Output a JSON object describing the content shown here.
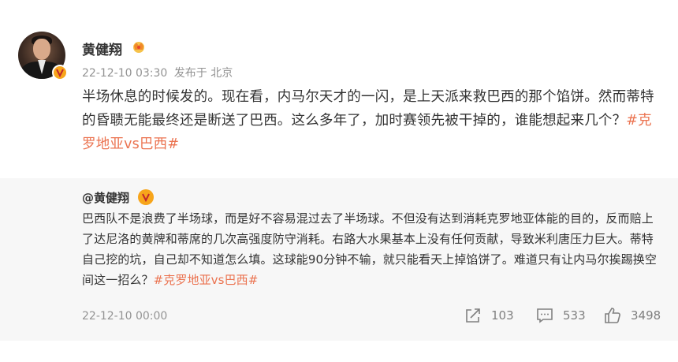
{
  "post": {
    "author": "黄健翔",
    "time": "22-12-10 03:30",
    "source": "发布于 北京",
    "text_main": "半场休息的时候发的。现在看，内马尔天才的一闪，是上天派来救巴西的那个馅饼。然而蒂特的昏聩无能最终还是断送了巴西。这么多年了，加时赛领先被干掉的，谁能想起来几个？",
    "hashtag": "#克罗地亚vs巴西#"
  },
  "repost": {
    "author": "@黄健翔",
    "text_main": "巴西队不是浪费了半场球，而是好不容易混过去了半场球。不但没有达到消耗克罗地亚体能的目的，反而赔上了达尼洛的黄牌和蒂席的几次高强度防守消耗。右路大水果基本上没有任何贡献，导致米利唐压力巨大。蒂特自己挖的坑，自己却不知道怎么填。这球能90分钟不输，就只能看天上掉馅饼了。难道只有让内马尔挨踢换空间这一招么？",
    "hashtag": "#克罗地亚vs巴西#",
    "time": "22-12-10 00:00",
    "share_count": "103",
    "comment_count": "533",
    "like_count": "3498"
  },
  "icons": {
    "verified": "verified-v-badge",
    "crown": "crown-icon",
    "share": "share-icon",
    "comment": "comment-icon",
    "like": "thumbs-up-icon"
  },
  "colors": {
    "hashtag": "#eb7350",
    "meta": "#939393",
    "repost_bg": "#f7f7f7",
    "badge": "#f7a51b"
  }
}
